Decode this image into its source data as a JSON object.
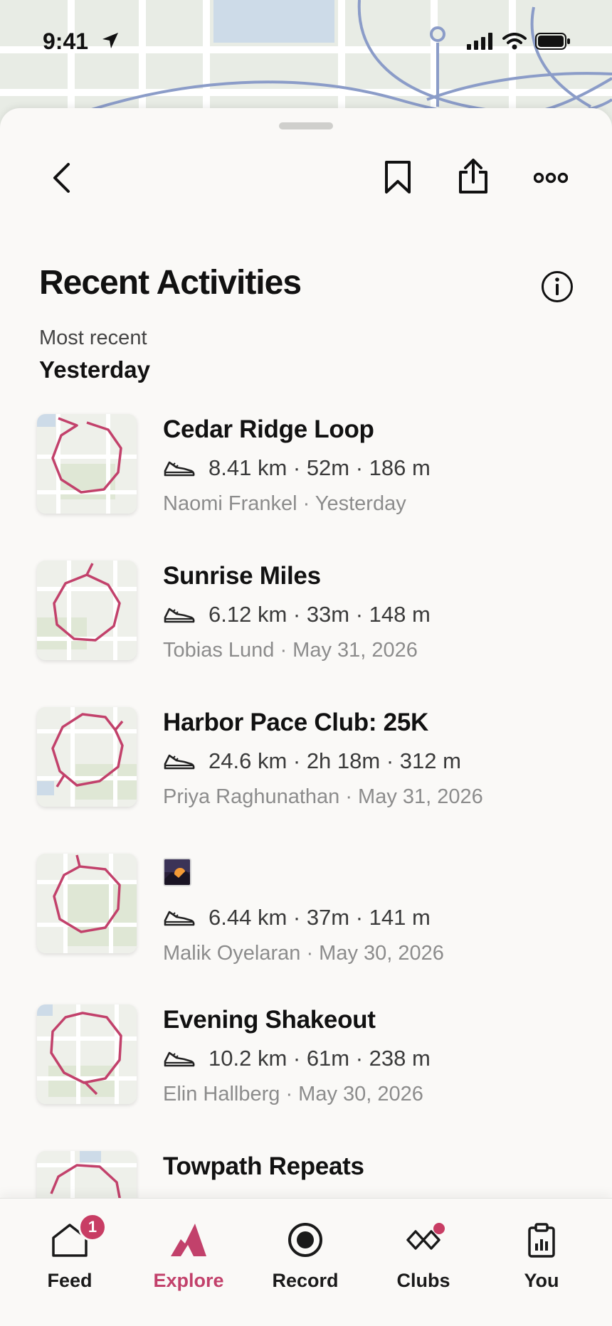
{
  "status": {
    "time": "9:41"
  },
  "header": {
    "title": "Recent Activities",
    "section_sub": "Most recent",
    "section_head": "Yesterday"
  },
  "activities": [
    {
      "title": "Cedar Ridge Loop",
      "stats": "8.41 km · 52m · 186 m",
      "meta": "Naomi Frankel · Yesterday",
      "has_photo": false
    },
    {
      "title": "Sunrise Miles",
      "stats": "6.12 km · 33m · 148 m",
      "meta": "Tobias Lund · May 31, 2026",
      "has_photo": false
    },
    {
      "title": "Harbor Pace Club: 25K",
      "stats": "24.6 km · 2h 18m · 312 m",
      "meta": "Priya Raghunathan · May 31, 2026",
      "has_photo": false
    },
    {
      "title": "",
      "stats": "6.44 km · 37m · 141 m",
      "meta": "Malik Oyelaran · May 30, 2026",
      "has_photo": true
    },
    {
      "title": "Evening Shakeout",
      "stats": "10.2 km · 61m · 238 m",
      "meta": "Elin Hallberg · May 30, 2026",
      "has_photo": false
    },
    {
      "title": "Towpath Repeats",
      "stats": "",
      "meta": "",
      "has_photo": false
    }
  ],
  "tabs": [
    {
      "label": "Feed",
      "icon": "home-icon",
      "badge": "1"
    },
    {
      "label": "Explore",
      "icon": "explore-icon",
      "active": true
    },
    {
      "label": "Record",
      "icon": "record-icon"
    },
    {
      "label": "Clubs",
      "icon": "clubs-icon",
      "dot": true
    },
    {
      "label": "You",
      "icon": "you-icon"
    }
  ],
  "colors": {
    "accent": "#c2416b",
    "route": "#c2416b",
    "map_road": "#8b9cc8",
    "badge": "#c83d64"
  }
}
